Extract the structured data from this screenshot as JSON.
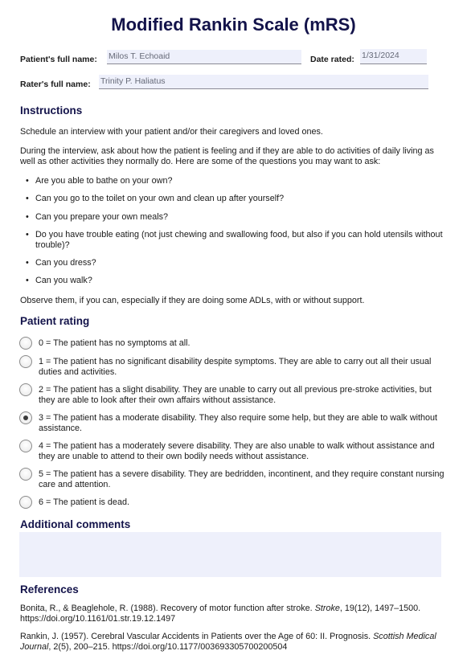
{
  "title": "Modified Rankin Scale (mRS)",
  "fields": {
    "patient_label": "Patient's full name:",
    "patient_value": "Milos T. Echoaid",
    "date_label": "Date rated:",
    "date_value": "1/31/2024",
    "rater_label": "Rater's full name:",
    "rater_value": "Trinity P. Haliatus"
  },
  "instructions": {
    "heading": "Instructions",
    "para1": "Schedule an interview with your patient and/or their caregivers and loved ones.",
    "para2": "During the interview, ask about how the patient is feeling and if they are able to do activities of daily living as well as other activities they normally do. Here are some of the questions you may want to ask:",
    "questions": [
      "Are you able to bathe on your own?",
      "Can you go to the toilet on your own and clean up after yourself?",
      "Can you prepare your own meals?",
      "Do you have trouble eating (not just chewing and swallowing food, but also if you can hold utensils without trouble)?",
      "Can you dress?",
      "Can you walk?"
    ],
    "para3": "Observe them, if you can, especially if they are doing some ADLs, with or without support."
  },
  "rating": {
    "heading": "Patient rating",
    "selected": 3,
    "options": [
      "0 = The patient has no symptoms at all.",
      "1 = The patient has no significant disability despite symptoms. They are able to carry out all their usual duties and activities.",
      "2 = The patient has a slight disability. They are unable to carry out all previous pre-stroke activities, but they are able to look after their own affairs without assistance.",
      "3 = The patient has a moderate disability. They also require some help, but they are able to walk without assistance.",
      "4 = The patient has a moderately severe disability. They are also unable to walk without assistance and they are unable to attend to their own bodily needs without assistance.",
      "5 = The patient has a severe disability. They are bedridden, incontinent, and they require constant nursing care and attention.",
      "6 = The patient is dead."
    ]
  },
  "comments": {
    "heading": "Additional comments",
    "value": ""
  },
  "references": {
    "heading": "References",
    "items": [
      {
        "before": "Bonita, R., & Beaglehole, R. (1988). Recovery of motor function after stroke. ",
        "italic": "Stroke",
        "after": ", 19(12), 1497–1500. https://doi.org/10.1161/01.str.19.12.1497"
      },
      {
        "before": "Rankin, J. (1957). Cerebral Vascular Accidents in Patients over the Age of 60: II. Prognosis. ",
        "italic": "Scottish Medical Journal",
        "after": ", 2(5), 200–215. https://doi.org/10.1177/003693305700200504"
      }
    ]
  },
  "colors": {
    "heading": "#13134a",
    "field_bg": "#eef0fb"
  }
}
